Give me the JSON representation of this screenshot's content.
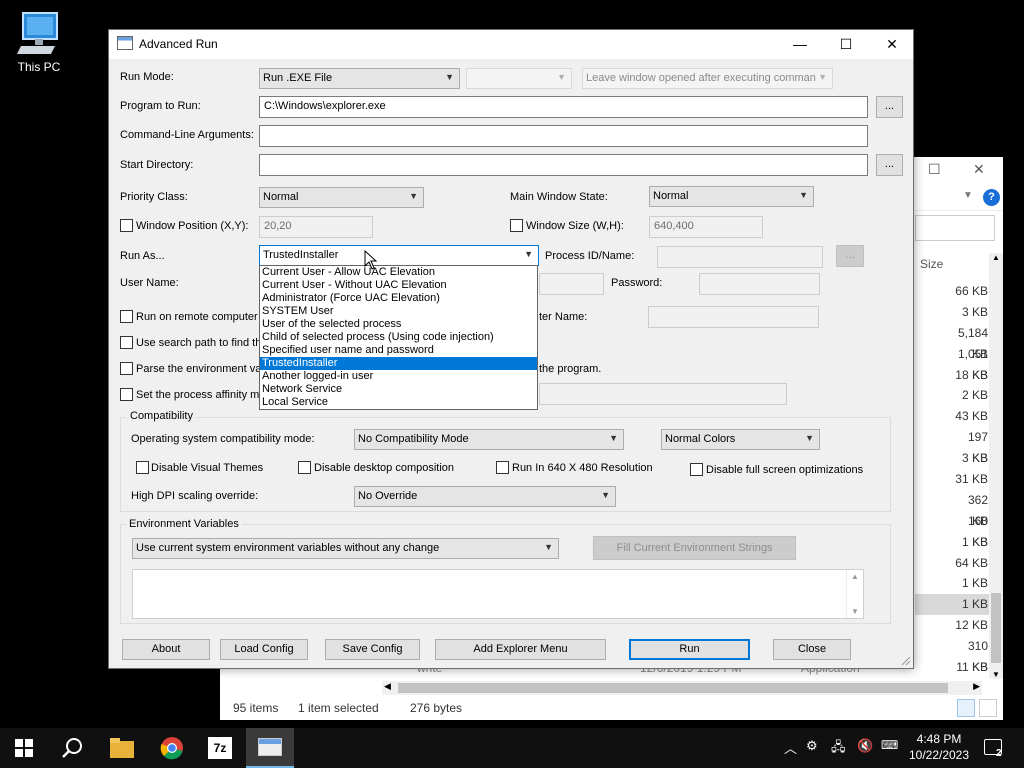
{
  "desktop": {
    "icon_label": "This PC"
  },
  "explorer_bg": {
    "size_header": "Size",
    "sizes": [
      "66 KB",
      "3 KB",
      "5,184 KB",
      "1,051 KB",
      "18 KB",
      "2 KB",
      "43 KB",
      "197 KB",
      "3 KB",
      "31 KB",
      "362 KB",
      "160 KB",
      "1 KB",
      "64 KB",
      "1 KB",
      "1 KB",
      "12 KB",
      "310 KB",
      "11 KB"
    ],
    "row_behind": {
      "name": "write",
      "date": "12/6/2019 1:29 PM",
      "type": "Application"
    },
    "status": {
      "items": "95 items",
      "selected": "1 item selected",
      "size": "276 bytes"
    }
  },
  "dialog": {
    "title": "Advanced Run",
    "run_mode": {
      "label": "Run Mode:",
      "value": "Run .EXE File",
      "second_combo_value": "",
      "leave_open": "Leave window opened after executing comman"
    },
    "program": {
      "label": "Program to Run:",
      "value": "C:\\Windows\\explorer.exe",
      "browse": "..."
    },
    "cmdline": {
      "label": "Command-Line Arguments:",
      "value": ""
    },
    "startdir": {
      "label": "Start Directory:",
      "value": "",
      "browse": "..."
    },
    "priority": {
      "label": "Priority Class:",
      "value": "Normal"
    },
    "main_window_state": {
      "label": "Main Window State:",
      "value": "Normal"
    },
    "window_position": {
      "label": "Window Position (X,Y):",
      "value": "20,20"
    },
    "window_size": {
      "label": "Window Size (W,H):",
      "value": "640,400"
    },
    "run_as": {
      "label": "Run As...",
      "value": "TrustedInstaller",
      "options": [
        "Current User - Allow UAC Elevation",
        "Current User - Without UAC Elevation",
        "Administrator (Force UAC Elevation)",
        "SYSTEM User",
        "User of the selected process",
        "Child of selected process (Using code injection)",
        "Specified user name and password",
        "TrustedInstaller",
        "Another logged-in user",
        "Network Service",
        "Local Service"
      ],
      "selected_index": 7
    },
    "process_id": {
      "label": "Process ID/Name:",
      "value": "",
      "browse": "..."
    },
    "user_name": {
      "label": "User Name:",
      "value": ""
    },
    "password": {
      "label": "Password:",
      "value": ""
    },
    "remote": {
      "label": "Run on remote computer",
      "computer_label": "ter Name:",
      "value": ""
    },
    "search_path": {
      "label": "Use search path to find th"
    },
    "parse_env": {
      "label": "Parse the environment va",
      "tail": "the program."
    },
    "affinity": {
      "label": "Set the process affinity m",
      "value": ""
    },
    "compat": {
      "title": "Compatibility",
      "os_mode_label": "Operating system compatibility mode:",
      "os_mode_value": "No Compatibility Mode",
      "colors_value": "Normal Colors",
      "disable_visual_themes": "Disable Visual Themes",
      "disable_desktop_composition": "Disable desktop composition",
      "run_640": "Run In 640 X 480 Resolution",
      "disable_fullscreen": "Disable full screen optimizations",
      "dpi_label": "High DPI scaling override:",
      "dpi_value": "No Override"
    },
    "env": {
      "title": "Environment Variables",
      "value": "Use current system environment variables without any change",
      "fill_button": "Fill Current Environment Strings"
    },
    "buttons": {
      "about": "About",
      "load": "Load Config",
      "save": "Save Config",
      "explorer_menu": "Add Explorer Menu",
      "run": "Run",
      "close": "Close"
    }
  },
  "taskbar": {
    "time": "4:48 PM",
    "date": "10/22/2023",
    "notification_count": "2"
  }
}
